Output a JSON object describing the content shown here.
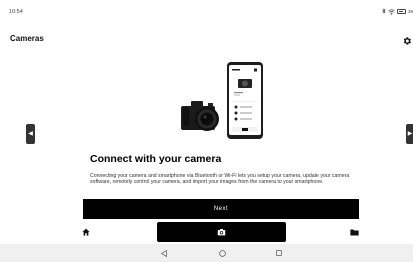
{
  "status_bar": {
    "time": "10:54",
    "battery": "38"
  },
  "header": {
    "title": "Cameras",
    "settings_icon": "gear-icon"
  },
  "hero": {
    "phone_illustration": "smartphone-app-screen",
    "camera_illustration": "mirrorless-camera"
  },
  "carousel": {
    "prev_icon": "chevron-left-icon",
    "next_icon": "chevron-right-icon"
  },
  "onboarding": {
    "headline": "Connect with your camera",
    "description": "Connecting your camera and smartphone via Bluetooth or Wi-Fi lets you setup your camera, update your camera software, remotely control your camera, and import your images from the camera to your smartphone."
  },
  "actions": {
    "next_label": "Next"
  },
  "tabbar": {
    "tabs": [
      {
        "name": "home",
        "icon": "home-icon",
        "active": false
      },
      {
        "name": "camera",
        "icon": "camera-icon",
        "active": true
      },
      {
        "name": "files",
        "icon": "folder-icon",
        "active": false
      }
    ]
  },
  "system_nav": {
    "back_icon": "triangle-back-icon",
    "home_icon": "circle-home-icon",
    "recent_icon": "square-recent-icon"
  },
  "colors": {
    "accent": "#000000",
    "background": "#ffffff",
    "nav_background": "#f0f0f0"
  }
}
